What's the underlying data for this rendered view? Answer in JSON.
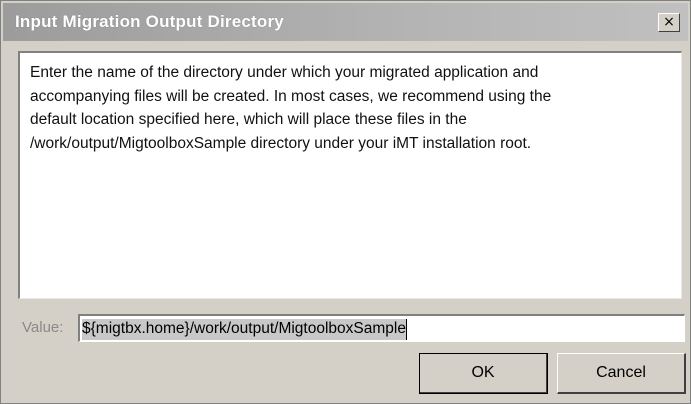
{
  "window": {
    "title": "Input Migration Output Directory",
    "close_glyph": "×"
  },
  "description": "Enter the name of the directory under which your migrated application and\naccompanying files will be created.  In most cases, we recommend using the\ndefault location specified here, which will place these files in the\n/work/output/MigtoolboxSample directory under your iMT installation root.",
  "value_field": {
    "label": "Value:",
    "value": "${migtbx.home}/work/output/MigtoolboxSample"
  },
  "buttons": {
    "ok_label": "OK",
    "cancel_label": "Cancel"
  }
}
